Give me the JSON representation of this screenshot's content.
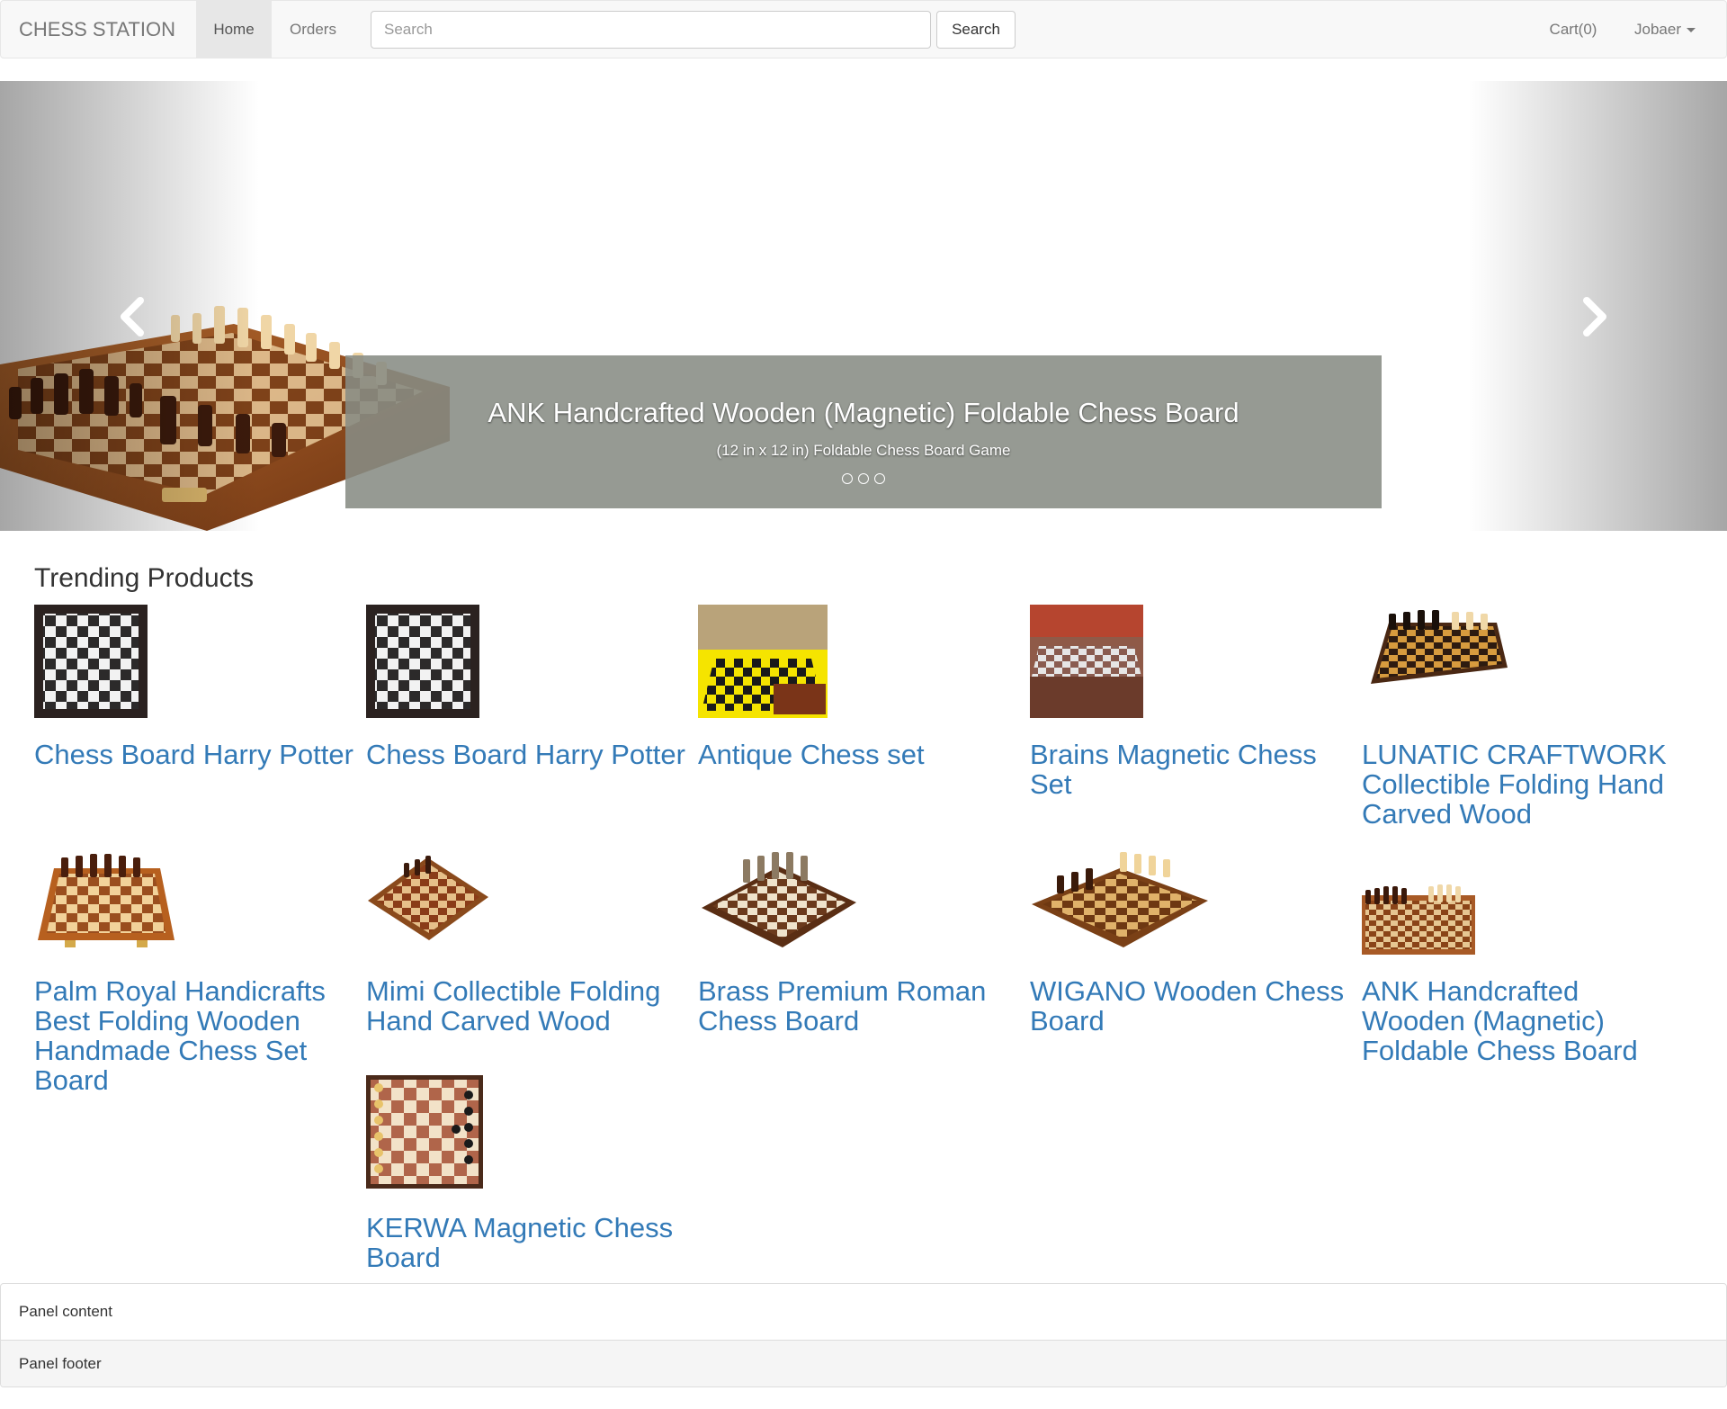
{
  "navbar": {
    "brand": "CHESS STATION",
    "home": "Home",
    "orders": "Orders",
    "search_placeholder": "Search",
    "search_button": "Search",
    "cart": "Cart(0)",
    "user": "Jobaer"
  },
  "carousel": {
    "title": "ANK Handcrafted Wooden (Magnetic) Foldable Chess Board",
    "subtitle": "(12 in x 12 in) Foldable Chess Board Game"
  },
  "trending": {
    "heading": "Trending Products",
    "products": [
      {
        "name": "Chess Board Harry Potter"
      },
      {
        "name": "Chess Board Harry Potter"
      },
      {
        "name": "Antique Chess set"
      },
      {
        "name": "Brains Magnetic Chess Set"
      },
      {
        "name": "LUNATIC CRAFTWORK Collectible Folding Hand Carved Wood"
      },
      {
        "name": "Palm Royal Handicrafts Best Folding Wooden Handmade Chess Set Board"
      },
      {
        "name": "Mimi Collectible Folding Hand Carved Wood"
      },
      {
        "name": "Brass Premium Roman Chess Board"
      },
      {
        "name": "WIGANO Wooden Chess Board"
      },
      {
        "name": "ANK Handcrafted Wooden (Magnetic) Foldable Chess Board"
      },
      {
        "name": "KERWA Magnetic Chess Board"
      }
    ]
  },
  "panel": {
    "content": "Panel content",
    "footer": "Panel footer"
  }
}
